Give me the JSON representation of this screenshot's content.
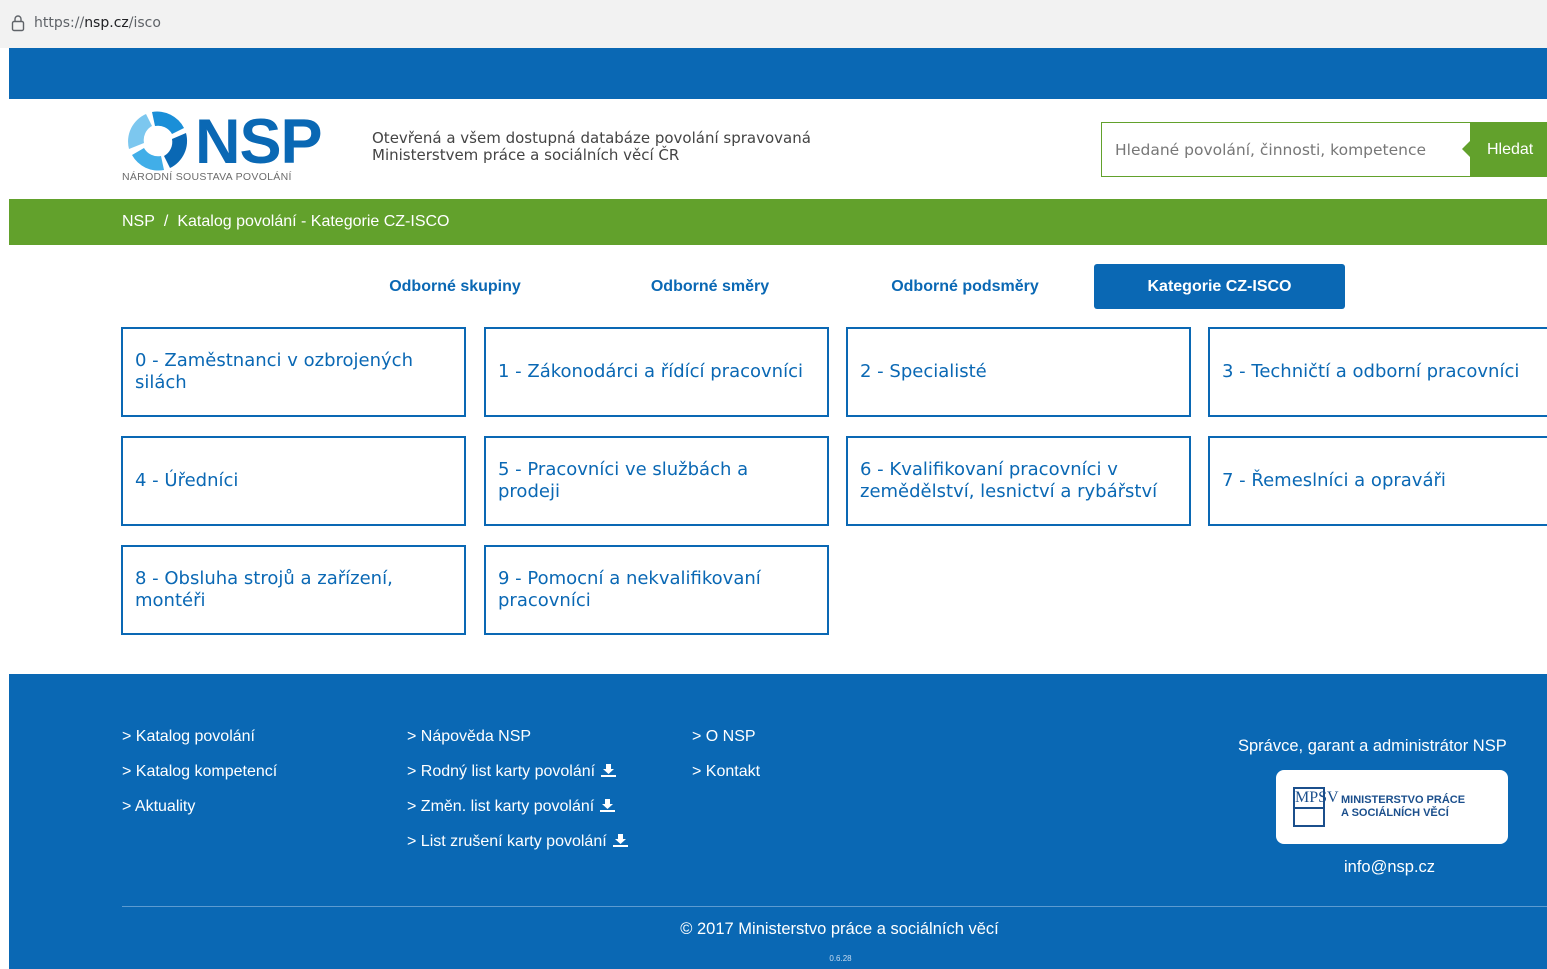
{
  "browser": {
    "url_prefix": "https://",
    "url_host": "nsp.cz",
    "url_path": "/isco"
  },
  "header": {
    "logo_text": "NSP",
    "logo_subtitle": "NÁRODNÍ SOUSTAVA POVOLÁNÍ",
    "tagline_line1": "Otevřená a všem dostupná databáze povolání spravovaná",
    "tagline_line2": "Ministerstvem práce a sociálních věcí ČR",
    "search_placeholder": "Hledané povolání, činnosti, kompetence",
    "search_button": "Hledat"
  },
  "breadcrumb": {
    "home": "NSP",
    "separator": "/",
    "current": "Katalog povolání - Kategorie CZ-ISCO"
  },
  "tabs": [
    {
      "label": "Odborné skupiny",
      "active": false
    },
    {
      "label": "Odborné směry",
      "active": false
    },
    {
      "label": "Odborné podsměry",
      "active": false
    },
    {
      "label": "Kategorie CZ-ISCO",
      "active": true
    }
  ],
  "categories": [
    {
      "label": "0 - Zaměstnanci v ozbrojených silách"
    },
    {
      "label": "1 - Zákonodárci a řídící pracovníci"
    },
    {
      "label": "2 - Specialisté"
    },
    {
      "label": "3 - Techničtí a odborní pracovníci"
    },
    {
      "label": "4 - Úředníci"
    },
    {
      "label": "5 - Pracovníci ve službách a prodeji"
    },
    {
      "label": "6 - Kvalifikovaní pracovníci v zemědělství, lesnictví a rybářství"
    },
    {
      "label": "7 - Řemeslníci a opraváři"
    },
    {
      "label": "8 - Obsluha strojů a zařízení, montéři"
    },
    {
      "label": "9 - Pomocní a nekvalifikovaní pracovníci"
    }
  ],
  "footer": {
    "col1": [
      "> Katalog povolání",
      "> Katalog kompetencí",
      "> Aktuality"
    ],
    "col2": [
      "> Nápověda NSP",
      "> Rodný list karty povolání",
      "> Změn. list karty povolání",
      "> List zrušení karty povolání"
    ],
    "col3": [
      "> O NSP",
      "> Kontakt"
    ],
    "admin_title": "Správce, garant a administrátor NSP",
    "mpsv_logo_letters": "MPSV",
    "mpsv_name_line1": "MINISTERSTVO PRÁCE",
    "mpsv_name_line2": "A SOCIÁLNÍCH VĚCÍ",
    "email": "info@nsp.cz",
    "copyright": "© 2017 Ministerstvo práce a sociálních věcí",
    "version": "0.6.28"
  },
  "colors": {
    "primary_blue": "#0a68b4",
    "green": "#62a12c"
  }
}
